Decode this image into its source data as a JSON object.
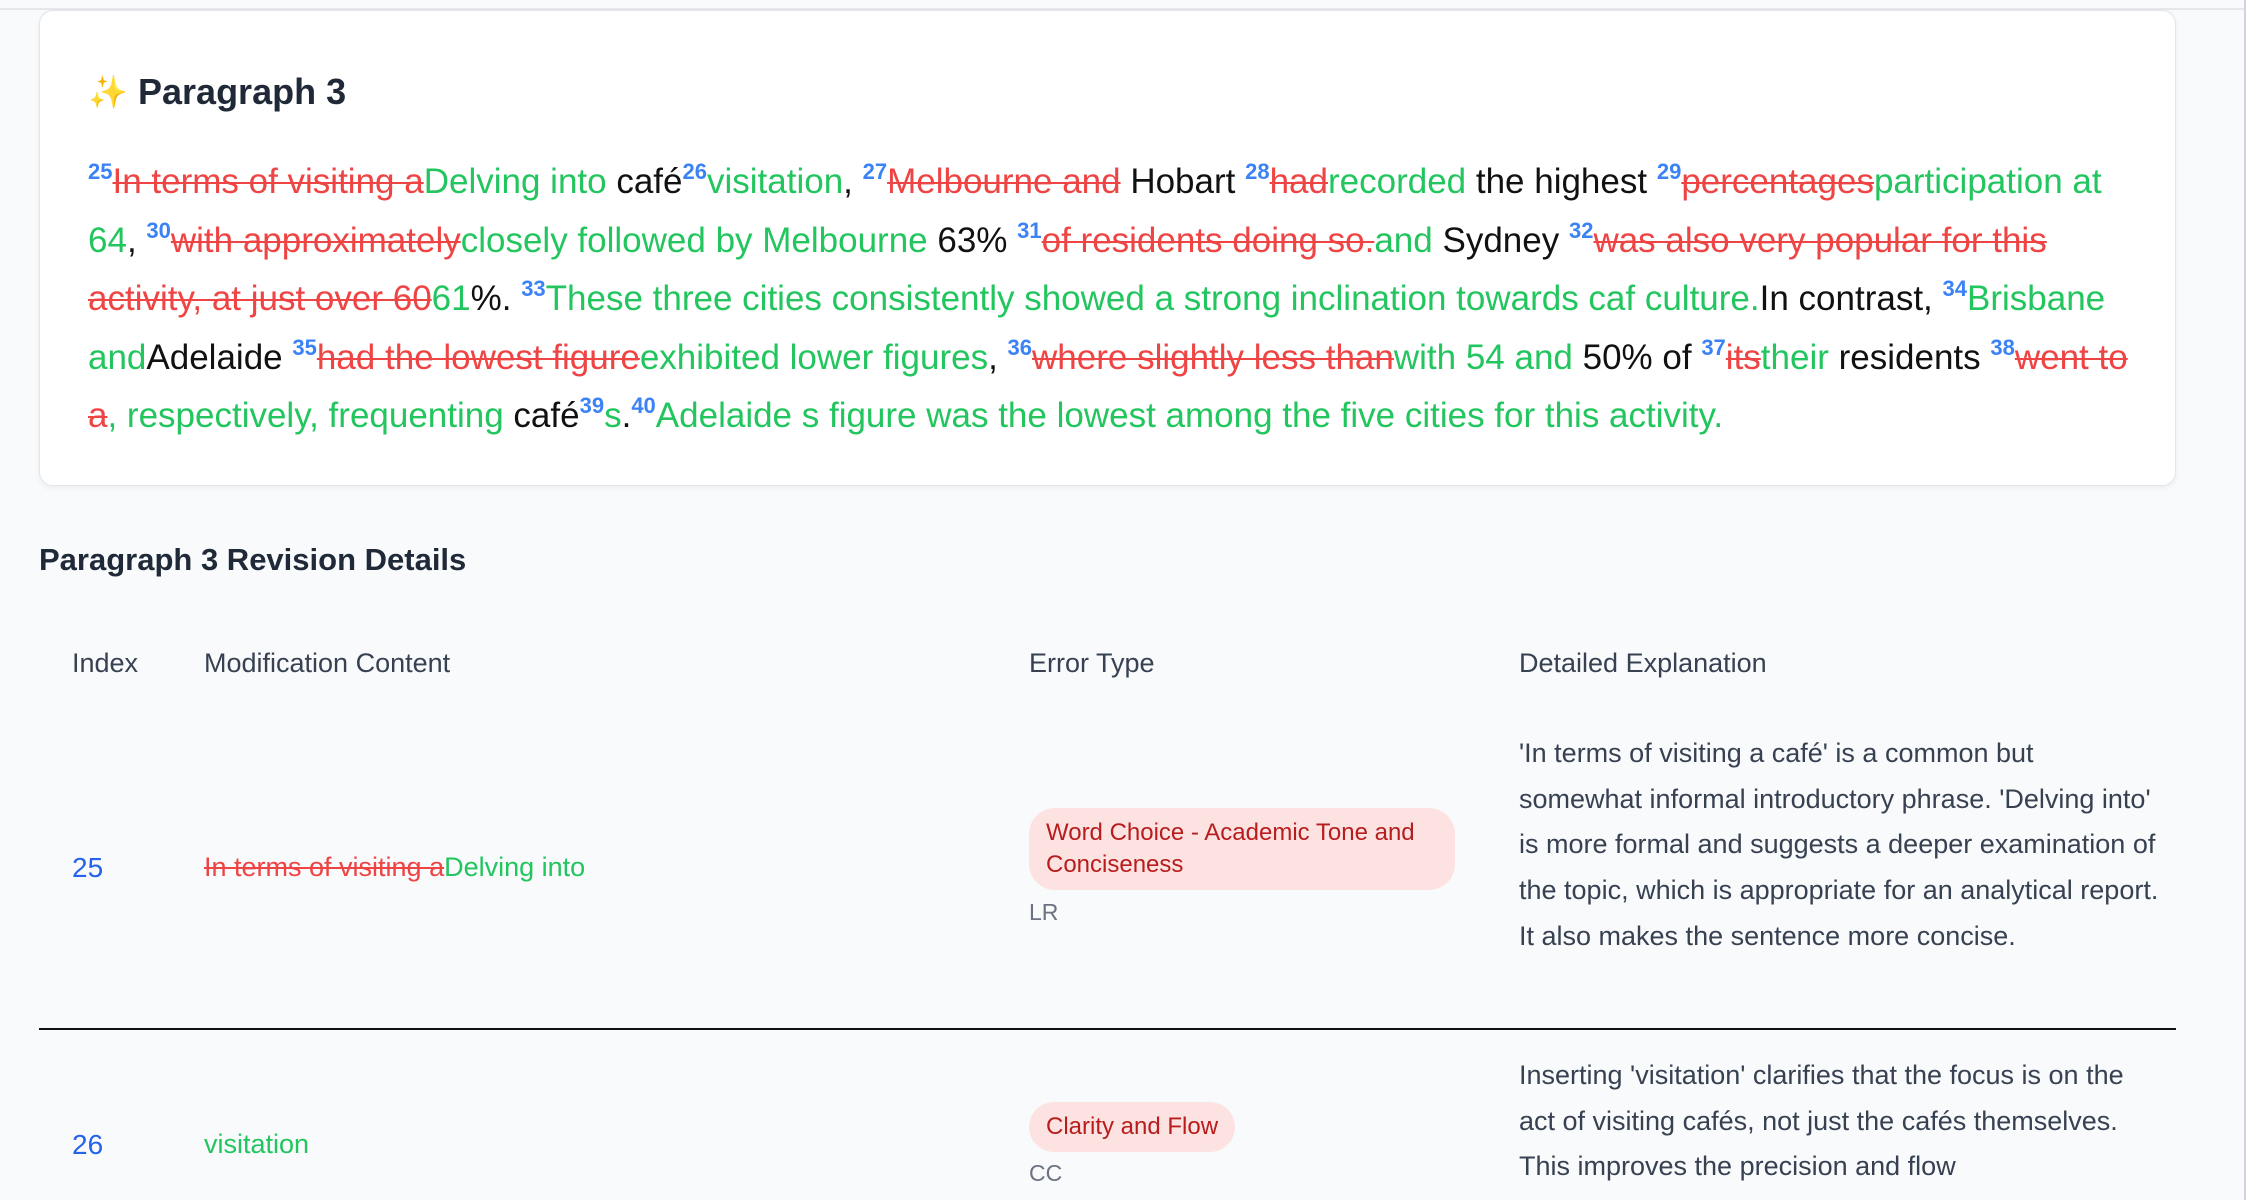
{
  "card": {
    "title": "Paragraph 3",
    "icon": "sparkle-icon",
    "segments": [
      {
        "type": "idx",
        "text": "25"
      },
      {
        "type": "del",
        "text": "In terms of visiting a"
      },
      {
        "type": "ins",
        "text": "Delving into"
      },
      {
        "type": "plain",
        "text": " café"
      },
      {
        "type": "idx",
        "text": "26"
      },
      {
        "type": "ins",
        "text": "visitation"
      },
      {
        "type": "plain",
        "text": ", "
      },
      {
        "type": "idx",
        "text": "27"
      },
      {
        "type": "del",
        "text": "Melbourne and"
      },
      {
        "type": "plain",
        "text": " Hobart "
      },
      {
        "type": "idx",
        "text": "28"
      },
      {
        "type": "del",
        "text": "had"
      },
      {
        "type": "ins",
        "text": "recorded"
      },
      {
        "type": "plain",
        "text": " the highest "
      },
      {
        "type": "idx",
        "text": "29"
      },
      {
        "type": "del",
        "text": "percentages"
      },
      {
        "type": "ins",
        "text": "participation at 64"
      },
      {
        "type": "plain",
        "text": ", "
      },
      {
        "type": "idx",
        "text": "30"
      },
      {
        "type": "del",
        "text": "with approximately"
      },
      {
        "type": "ins",
        "text": "closely followed by Melbourne"
      },
      {
        "type": "plain",
        "text": " 63% "
      },
      {
        "type": "idx",
        "text": "31"
      },
      {
        "type": "del",
        "text": "of residents doing so."
      },
      {
        "type": "ins",
        "text": "and"
      },
      {
        "type": "plain",
        "text": " Sydney "
      },
      {
        "type": "idx",
        "text": "32"
      },
      {
        "type": "del",
        "text": "was also very popular for this activity, at just over 60"
      },
      {
        "type": "ins",
        "text": "61"
      },
      {
        "type": "plain",
        "text": "%. "
      },
      {
        "type": "idx",
        "text": "33"
      },
      {
        "type": "ins",
        "text": "These three cities consistently showed a strong inclination towards caf culture."
      },
      {
        "type": "plain",
        "text": "In contrast, "
      },
      {
        "type": "idx",
        "text": "34"
      },
      {
        "type": "ins",
        "text": "Brisbane and"
      },
      {
        "type": "plain",
        "text": "Adelaide "
      },
      {
        "type": "idx",
        "text": "35"
      },
      {
        "type": "del",
        "text": "had the lowest figure"
      },
      {
        "type": "ins",
        "text": "exhibited lower figures"
      },
      {
        "type": "plain",
        "text": ", "
      },
      {
        "type": "idx",
        "text": "36"
      },
      {
        "type": "del",
        "text": "where slightly less than"
      },
      {
        "type": "ins",
        "text": "with 54 and"
      },
      {
        "type": "plain",
        "text": " 50% of "
      },
      {
        "type": "idx",
        "text": "37"
      },
      {
        "type": "del",
        "text": "its"
      },
      {
        "type": "ins",
        "text": "their"
      },
      {
        "type": "plain",
        "text": " residents "
      },
      {
        "type": "idx",
        "text": "38"
      },
      {
        "type": "del",
        "text": "went to a"
      },
      {
        "type": "ins",
        "text": ", respectively, frequenting"
      },
      {
        "type": "plain",
        "text": " café"
      },
      {
        "type": "idx",
        "text": "39"
      },
      {
        "type": "ins",
        "text": "s"
      },
      {
        "type": "plain",
        "text": "."
      },
      {
        "type": "idx",
        "text": "40"
      },
      {
        "type": "ins",
        "text": "Adelaide s figure was the lowest among the five cities for this activity."
      }
    ]
  },
  "details": {
    "title": "Paragraph 3 Revision Details",
    "headers": {
      "index": "Index",
      "modification": "Modification Content",
      "error_type": "Error Type",
      "explanation": "Detailed Explanation"
    },
    "rows": [
      {
        "index": "25",
        "mod_del": "In terms of visiting a",
        "mod_ins": "Delving into",
        "error_badge": "Word Choice - Academic Tone and Conciseness",
        "error_code": "LR",
        "explanation": "'In terms of visiting a café' is a common but somewhat informal introductory phrase. 'Delving into' is more formal and suggests a deeper examination of the topic, which is appropriate for an analytical report. It also makes the sentence more concise."
      },
      {
        "index": "26",
        "mod_del": "",
        "mod_ins": "visitation",
        "error_badge": "Clarity and Flow",
        "error_code": "CC",
        "explanation": "Inserting 'visitation' clarifies that the focus is on the act of visiting cafés, not just the cafés themselves. This improves the precision and flow"
      }
    ]
  }
}
